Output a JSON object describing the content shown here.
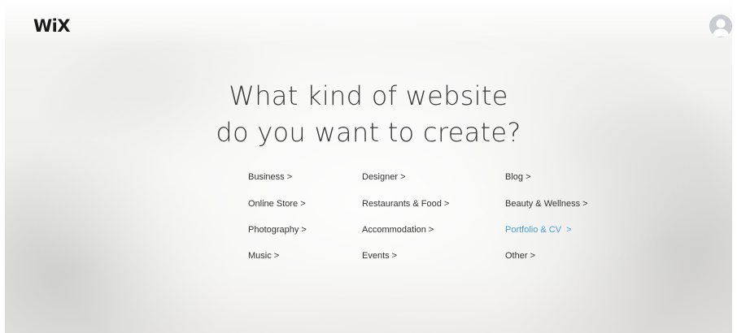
{
  "header": {
    "logo_text": "WiX"
  },
  "main": {
    "headline_line1": "What kind of website",
    "headline_line2": "do you want to create?"
  },
  "categories": {
    "business": "Business >",
    "online_store": "Online Store >",
    "photography": "Photography >",
    "music": "Music >",
    "designer": "Designer >",
    "restaurants_food": "Restaurants & Food >",
    "accommodation": "Accommodation >",
    "events": "Events >",
    "blog": "Blog >",
    "beauty_wellness": "Beauty & Wellness >",
    "portfolio_cv": "Portfolio & CV  >",
    "other": "Other >"
  },
  "colors": {
    "accent": "#4a9fd8",
    "text": "#333333",
    "headline": "#3c3c3c"
  },
  "icons": {
    "avatar": "user-avatar-icon"
  }
}
